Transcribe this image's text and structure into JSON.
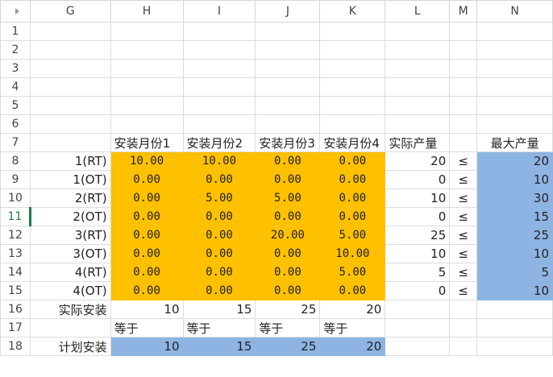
{
  "columns": [
    "G",
    "H",
    "I",
    "J",
    "K",
    "L",
    "M",
    "N"
  ],
  "rows": [
    "1",
    "2",
    "3",
    "4",
    "5",
    "6",
    "7",
    "8",
    "9",
    "10",
    "11",
    "12",
    "13",
    "14",
    "15",
    "16",
    "17",
    "18"
  ],
  "headers_row7": {
    "H": "安装月份1",
    "I": "安装月份2",
    "J": "安装月份3",
    "K": "安装月份4",
    "L": "实际产量",
    "N": "最大产量"
  },
  "data_rows": [
    {
      "G": "1(RT)",
      "H": "10.00",
      "I": "10.00",
      "J": "0.00",
      "K": "0.00",
      "L": "20",
      "M": "≤",
      "N": "20"
    },
    {
      "G": "1(OT)",
      "H": "0.00",
      "I": "0.00",
      "J": "0.00",
      "K": "0.00",
      "L": "0",
      "M": "≤",
      "N": "10"
    },
    {
      "G": "2(RT)",
      "H": "0.00",
      "I": "5.00",
      "J": "5.00",
      "K": "0.00",
      "L": "10",
      "M": "≤",
      "N": "30"
    },
    {
      "G": "2(OT)",
      "H": "0.00",
      "I": "0.00",
      "J": "0.00",
      "K": "0.00",
      "L": "0",
      "M": "≤",
      "N": "15"
    },
    {
      "G": "3(RT)",
      "H": "0.00",
      "I": "0.00",
      "J": "20.00",
      "K": "5.00",
      "L": "25",
      "M": "≤",
      "N": "25"
    },
    {
      "G": "3(OT)",
      "H": "0.00",
      "I": "0.00",
      "J": "0.00",
      "K": "10.00",
      "L": "10",
      "M": "≤",
      "N": "10"
    },
    {
      "G": "4(RT)",
      "H": "0.00",
      "I": "0.00",
      "J": "0.00",
      "K": "5.00",
      "L": "5",
      "M": "≤",
      "N": "5"
    },
    {
      "G": "4(OT)",
      "H": "0.00",
      "I": "0.00",
      "J": "0.00",
      "K": "0.00",
      "L": "0",
      "M": "≤",
      "N": "10"
    }
  ],
  "row16": {
    "G": "实际安装",
    "H": "10",
    "I": "15",
    "J": "25",
    "K": "20"
  },
  "row17": {
    "H": "等于",
    "I": "等于",
    "J": "等于",
    "K": "等于"
  },
  "row18": {
    "G": "计划安装",
    "H": "10",
    "I": "15",
    "J": "25",
    "K": "20"
  },
  "colors": {
    "input_fill": "#ffc000",
    "limit_fill": "#8eb4e3",
    "active_row": "#1e7b45"
  }
}
